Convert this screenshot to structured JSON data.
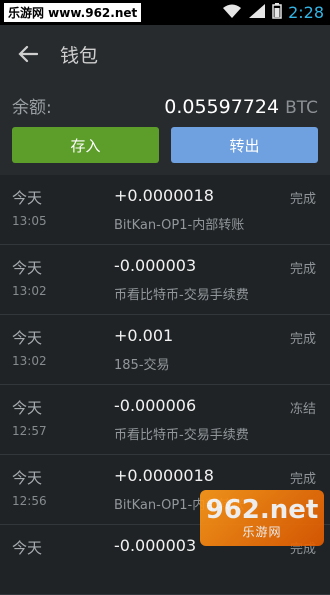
{
  "statusbar": {
    "watermark": "乐游网 www.962.net",
    "time": "2:28"
  },
  "appbar": {
    "title": "钱包"
  },
  "balance": {
    "label": "余额:",
    "value": "0.05597724",
    "unit": "BTC"
  },
  "actions": {
    "deposit": "存入",
    "withdraw": "转出"
  },
  "transactions": [
    {
      "day": "今天",
      "time": "13:05",
      "amount": "+0.0000018",
      "desc": "BitKan-OP1-内部转账",
      "status": "完成"
    },
    {
      "day": "今天",
      "time": "13:02",
      "amount": "-0.000003",
      "desc": "币看比特币-交易手续费",
      "status": "完成"
    },
    {
      "day": "今天",
      "time": "13:02",
      "amount": "+0.001",
      "desc": "185-交易",
      "status": "完成"
    },
    {
      "day": "今天",
      "time": "12:57",
      "amount": "-0.000006",
      "desc": "币看比特币-交易手续费",
      "status": "冻结"
    },
    {
      "day": "今天",
      "time": "12:56",
      "amount": "+0.0000018",
      "desc": "BitKan-OP1-内部转账",
      "status": "完成"
    },
    {
      "day": "今天",
      "time": "",
      "amount": "-0.000003",
      "desc": "",
      "status": "完成"
    }
  ],
  "logo": {
    "big": "962.net",
    "small": "乐游网"
  }
}
